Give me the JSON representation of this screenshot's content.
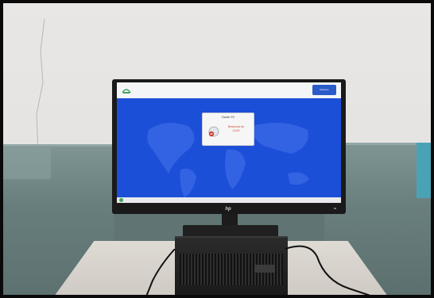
{
  "screen": {
    "topbar_button_label": "Reserve",
    "dialog_title": "Clavier PC",
    "dialog_line1": "Reserved for",
    "dialog_line2": "13:00",
    "taskbar_text": "Windows",
    "brand_logo": "hp"
  },
  "colors": {
    "screen_blue": "#1c4fd8",
    "dialog_text_red": "#d43a2f",
    "panel_teal": "#687e7d"
  }
}
